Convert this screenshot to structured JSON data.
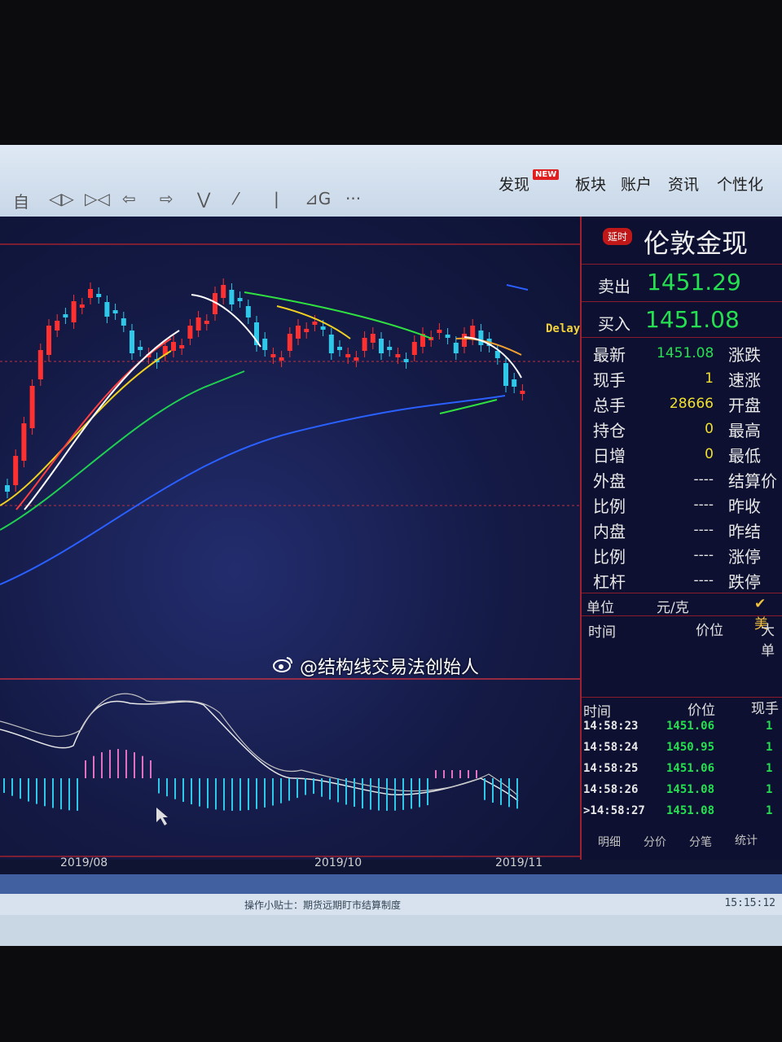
{
  "menu": {
    "items": [
      {
        "label": "发现",
        "badge": "NEW"
      },
      {
        "label": "板块"
      },
      {
        "label": "账户"
      },
      {
        "label": "资讯"
      },
      {
        "label": "个性化"
      }
    ]
  },
  "toolbar": {
    "icons": [
      "auto-icon",
      "left-right-icon",
      "shrink-icon",
      "arrow-left-icon",
      "arrow-right-icon",
      "chevron-down-double-icon",
      "draw-line-icon",
      "vertical-line-icon",
      "golden-ratio-icon",
      "more-icon"
    ],
    "auto_label": "自",
    "more_label": "···"
  },
  "chart": {
    "delay_label": "Delay",
    "xaxis_labels": [
      "2019/08",
      "2019/10",
      "2019/11"
    ]
  },
  "chart_data": {
    "type": "line",
    "series": [],
    "xlabel": "",
    "ylabel": "",
    "x_ticks": [
      "2019/08",
      "2019/10",
      "2019/11"
    ]
  },
  "quote": {
    "delay_badge": "延时",
    "title": "伦敦金现",
    "sell_label": "卖出",
    "sell_price": "1451.29",
    "buy_label": "买入",
    "buy_price": "1451.08",
    "rows_left": [
      {
        "label": "最新",
        "value": "1451.08"
      },
      {
        "label": "现手",
        "value": "1"
      },
      {
        "label": "总手",
        "value": "28666"
      },
      {
        "label": "持仓",
        "value": "0"
      },
      {
        "label": "日增",
        "value": "0"
      },
      {
        "label": "外盘",
        "value": "----"
      },
      {
        "label": "比例",
        "value": "----"
      },
      {
        "label": "内盘",
        "value": "----"
      },
      {
        "label": "比例",
        "value": "----"
      },
      {
        "label": "杠杆",
        "value": "----"
      }
    ],
    "rows_right": [
      "涨跌",
      "速涨",
      "开盘",
      "最高",
      "最低",
      "结算价",
      "昨收",
      "昨结",
      "涨停",
      "跌停"
    ],
    "unit_label": "单位",
    "unit_value": "元/克",
    "unit_check": "✔ 美",
    "col_time": "时间",
    "col_price": "价位",
    "col_big": "大单",
    "trades_header": {
      "time": "时间",
      "price": "价位",
      "vol": "现手"
    },
    "trades": [
      {
        "time": "14:58:23",
        "price": "1451.06",
        "vol": "1"
      },
      {
        "time": "14:58:24",
        "price": "1450.95",
        "vol": "1"
      },
      {
        "time": "14:58:25",
        "price": "1451.06",
        "vol": "1"
      },
      {
        "time": "14:58:26",
        "price": "1451.08",
        "vol": "1"
      },
      {
        "time": ">14:58:27",
        "price": "1451.08",
        "vol": "1"
      }
    ],
    "tabs": [
      "明细",
      "分价",
      "分笔",
      "统计"
    ]
  },
  "watermark": "@结构线交易法创始人",
  "status": {
    "message": "操作小贴士：期货远期盯市结算制度",
    "clock": "15:15:12"
  },
  "colors": {
    "up": "#ff3030",
    "down": "#30c8e8",
    "green": "#25e050",
    "bg": "#141a45"
  }
}
